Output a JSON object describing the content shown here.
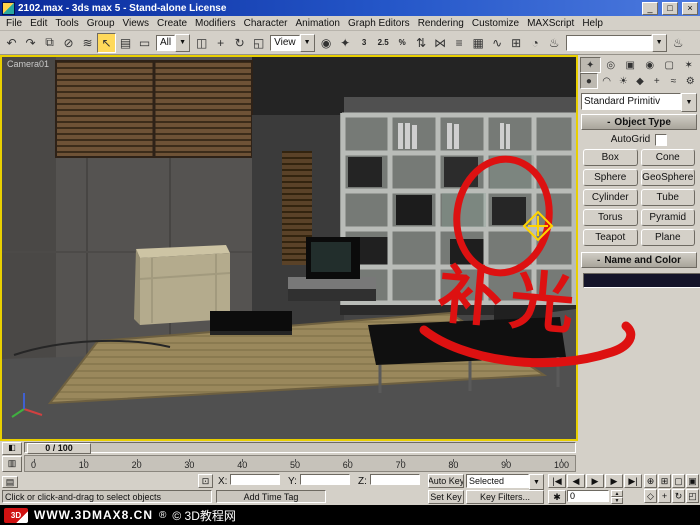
{
  "colors": {
    "ui_gray": "#d4d0c8",
    "titlebar_blue": "#2456c8",
    "viewport_border_yellow": "#e8cf00",
    "annotation_red": "#dd1111",
    "gizmo_yellow": "#ffd400",
    "branding_bg": "#000000"
  },
  "ui": {
    "dropdown_arrow": "▼",
    "spinner_up": "▲",
    "spinner_down": "▼"
  },
  "titlebar": {
    "title": "2102.max - 3ds max 5 - Stand-alone License",
    "minimize_glyph": "_",
    "maximize_glyph": "□",
    "close_glyph": "×"
  },
  "menubar": {
    "items": [
      "File",
      "Edit",
      "Tools",
      "Group",
      "Views",
      "Create",
      "Modifiers",
      "Character",
      "Animation",
      "Graph Editors",
      "Rendering",
      "Customize",
      "MAXScript",
      "Help"
    ]
  },
  "toolbar": {
    "icons_left": [
      {
        "name": "undo",
        "glyph": "↶"
      },
      {
        "name": "redo",
        "glyph": "↷"
      },
      {
        "name": "select-and-link",
        "glyph": "⧉"
      },
      {
        "name": "unlink-selection",
        "glyph": "⊘"
      },
      {
        "name": "bind-to-space-warp",
        "glyph": "≋"
      },
      {
        "name": "select-object",
        "glyph": "↖"
      },
      {
        "name": "select-by-name",
        "glyph": "▤"
      },
      {
        "name": "selection-region",
        "glyph": "▭"
      }
    ],
    "selection_filter_value": "All",
    "icons_mid": [
      {
        "name": "window-crossing-toggle",
        "glyph": "◫"
      },
      {
        "name": "select-and-move",
        "glyph": "+"
      },
      {
        "name": "select-and-rotate",
        "glyph": "↻"
      },
      {
        "name": "select-and-scale",
        "glyph": "◱"
      }
    ],
    "ref_coord_value": "View",
    "icons_right": [
      {
        "name": "use-pivot-point-center",
        "glyph": "◉"
      },
      {
        "name": "select-and-manipulate",
        "glyph": "✦"
      },
      {
        "name": "snap-toggle",
        "glyph": "3"
      },
      {
        "name": "angle-snap-toggle",
        "glyph": "2.5"
      },
      {
        "name": "percent-snap-toggle",
        "glyph": "%"
      },
      {
        "name": "spinner-snap-toggle",
        "glyph": "⇅"
      },
      {
        "name": "mirror",
        "glyph": "⋈"
      },
      {
        "name": "align",
        "glyph": "≡"
      },
      {
        "name": "layer-manager",
        "glyph": "▦"
      },
      {
        "name": "curve-editor",
        "glyph": "∿"
      },
      {
        "name": "schematic-view",
        "glyph": "⊞"
      },
      {
        "name": "material-editor",
        "glyph": "◔"
      },
      {
        "name": "render-scene",
        "glyph": "♨"
      }
    ],
    "render_preset_value": "",
    "icons_far": [
      {
        "name": "quick-render",
        "glyph": "♨"
      }
    ]
  },
  "viewport": {
    "camera_label": "Camera01"
  },
  "annotation": {
    "text": "补光"
  },
  "command_panel": {
    "collapse_glyph": "-",
    "tabs": [
      {
        "name": "create",
        "glyph": "✦"
      },
      {
        "name": "modify",
        "glyph": "◎"
      },
      {
        "name": "hierarchy",
        "glyph": "▣"
      },
      {
        "name": "motion",
        "glyph": "◉"
      },
      {
        "name": "display",
        "glyph": "▢"
      },
      {
        "name": "utilities",
        "glyph": "✶"
      }
    ],
    "categories": [
      {
        "name": "geometry",
        "glyph": "●"
      },
      {
        "name": "shapes",
        "glyph": "◠"
      },
      {
        "name": "lights",
        "glyph": "☀"
      },
      {
        "name": "cameras",
        "glyph": "◆"
      },
      {
        "name": "helpers",
        "glyph": "+"
      },
      {
        "name": "space-warps",
        "glyph": "≈"
      },
      {
        "name": "systems",
        "glyph": "⚙"
      }
    ],
    "object_class_value": "Standard Primitiv",
    "object_type": {
      "header": "Object Type",
      "autogrid_label": "AutoGrid",
      "buttons": [
        "Box",
        "Cone",
        "Sphere",
        "GeoSphere",
        "Cylinder",
        "Tube",
        "Torus",
        "Pyramid",
        "Teapot",
        "Plane"
      ]
    },
    "name_color": {
      "header": "Name and Color",
      "name_value": ""
    }
  },
  "timeline": {
    "slider_label": "0 / 100",
    "slider_left_glyph": "◧"
  },
  "trackbar": {
    "ruler_left_glyph": "▥",
    "ticks": [
      "0",
      "10",
      "20",
      "30",
      "40",
      "50",
      "60",
      "70",
      "80",
      "90",
      "100"
    ]
  },
  "status": {
    "listener_glyph": "▤",
    "lock_glyph": "⊡",
    "prompt": "Click or click-and-drag to select objects",
    "time_tag": "Add Time Tag",
    "x_label": "X:",
    "y_label": "Y:",
    "z_label": "Z:",
    "x_value": "",
    "y_value": "",
    "z_value": "",
    "auto_key_label": "Auto Key",
    "set_key_label": "Set Key",
    "key_subset_value": "Selected",
    "key_filters_label": "Key Filters..."
  },
  "playback": {
    "goto_start_glyph": "|◀",
    "prev_glyph": "◀",
    "play_glyph": "▶",
    "next_glyph": "▶",
    "goto_end_glyph": "▶|",
    "key_mode_glyph": "✱",
    "frame_value": "0"
  },
  "nav": {
    "buttons": [
      {
        "name": "zoom",
        "glyph": "⊕"
      },
      {
        "name": "zoom-all",
        "glyph": "⊞"
      },
      {
        "name": "zoom-extents",
        "glyph": "▢"
      },
      {
        "name": "zoom-extents-all",
        "glyph": "▣"
      },
      {
        "name": "field-of-view",
        "glyph": "◇"
      },
      {
        "name": "pan",
        "glyph": "+"
      },
      {
        "name": "arc-rotate",
        "glyph": "↻"
      },
      {
        "name": "min-max-toggle",
        "glyph": "◰"
      }
    ]
  },
  "branding": {
    "site": "WWW.3DMAX8.CN",
    "reg": "®",
    "suffix": "© 3D教程网",
    "logo_text": "3D"
  }
}
